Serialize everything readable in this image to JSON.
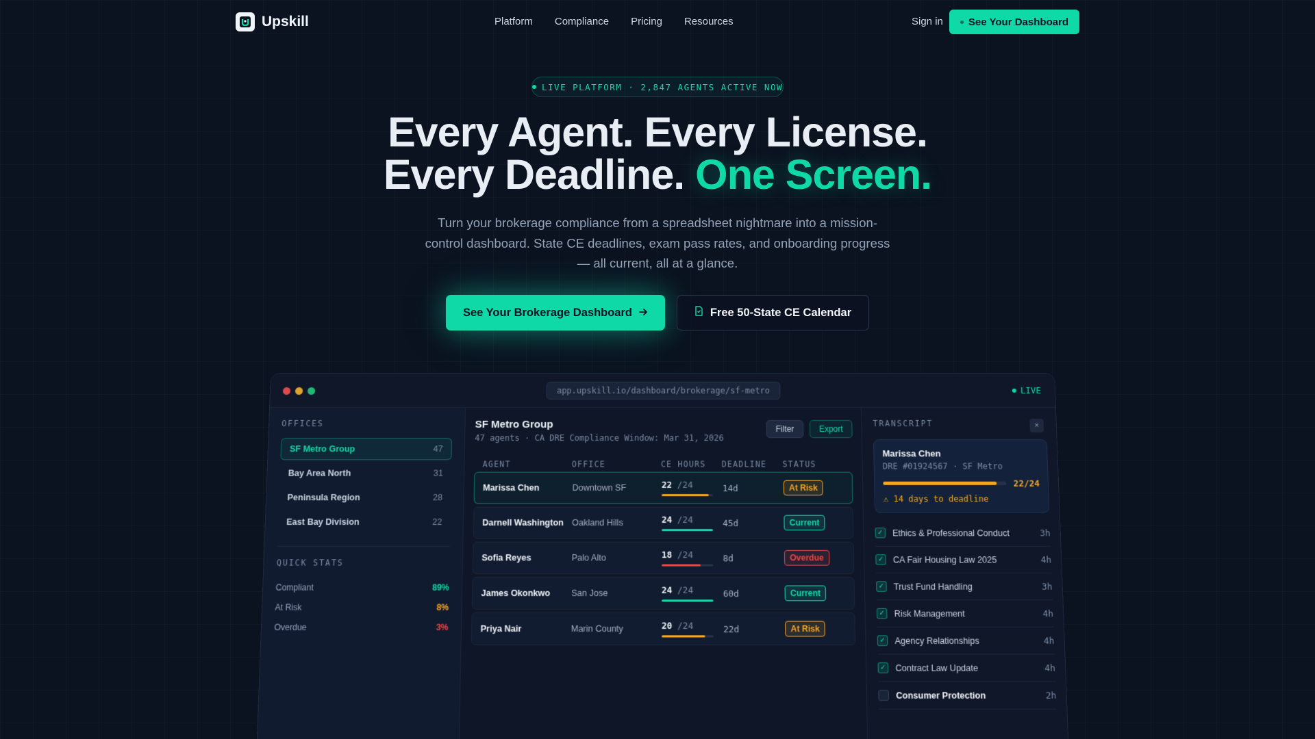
{
  "nav": {
    "brand": "Upskill",
    "links": [
      "Platform",
      "Compliance",
      "Pricing",
      "Resources"
    ],
    "signin": "Sign in",
    "cta": "See Your Dashboard"
  },
  "hero": {
    "pill": "LIVE PLATFORM · 2,847 AGENTS ACTIVE NOW",
    "headline_line1": "Every Agent. Every License.",
    "headline_line2_a": "Every Deadline. ",
    "headline_line2_b": "One Screen.",
    "subtitle": "Turn your brokerage compliance from a spreadsheet nightmare into a mission-control dashboard. State CE deadlines, exam pass rates, and onboarding progress — all current, all at a glance.",
    "cta_primary": "See Your Brokerage Dashboard",
    "cta_secondary": "Free 50-State CE Calendar"
  },
  "app": {
    "url": "app.upskill.io/dashboard/brokerage/sf-metro",
    "live": "LIVE",
    "sidebar": {
      "offices_label": "OFFICES",
      "offices": [
        {
          "name": "SF Metro Group",
          "count": "47"
        },
        {
          "name": "Bay Area North",
          "count": "31"
        },
        {
          "name": "Peninsula Region",
          "count": "28"
        },
        {
          "name": "East Bay Division",
          "count": "22"
        }
      ],
      "stats_label": "QUICK STATS",
      "stats": [
        {
          "label": "Compliant",
          "value": "89%",
          "color": "#10d9a8"
        },
        {
          "label": "At Risk",
          "value": "8%",
          "color": "#f5a623"
        },
        {
          "label": "Overdue",
          "value": "3%",
          "color": "#ef4444"
        }
      ]
    },
    "main": {
      "title": "SF Metro Group",
      "subtitle": "47 agents · CA DRE Compliance Window: Mar 31, 2026",
      "filter": "Filter",
      "export": "Export",
      "columns": [
        "AGENT",
        "OFFICE",
        "CE HOURS",
        "DEADLINE",
        "STATUS"
      ],
      "rows": [
        {
          "agent": "Marissa Chen",
          "office": "Downtown SF",
          "hours": "22",
          "of": "/24",
          "progress": 0.917,
          "deadline": "14d",
          "status": "At Risk",
          "tone": "risk"
        },
        {
          "agent": "Darnell Washington",
          "office": "Oakland Hills",
          "hours": "24",
          "of": "/24",
          "progress": 1.0,
          "deadline": "45d",
          "status": "Current",
          "tone": "ok"
        },
        {
          "agent": "Sofia Reyes",
          "office": "Palo Alto",
          "hours": "18",
          "of": "/24",
          "progress": 0.75,
          "deadline": "8d",
          "status": "Overdue",
          "tone": "bad"
        },
        {
          "agent": "James Okonkwo",
          "office": "San Jose",
          "hours": "24",
          "of": "/24",
          "progress": 1.0,
          "deadline": "60d",
          "status": "Current",
          "tone": "ok"
        },
        {
          "agent": "Priya Nair",
          "office": "Marin County",
          "hours": "20",
          "of": "/24",
          "progress": 0.833,
          "deadline": "22d",
          "status": "At Risk",
          "tone": "risk"
        }
      ],
      "tones": {
        "ok": "#10d9a8",
        "risk": "#f5a623",
        "bad": "#ef4444"
      }
    },
    "transcript": {
      "label": "TRANSCRIPT",
      "close": "×",
      "name": "Marissa Chen",
      "id": "DRE #01924567 · SF Metro",
      "progress": 0.917,
      "progress_text": "22/24",
      "warning": "⚠ 14 days to deadline",
      "courses": [
        {
          "name": "Ethics & Professional Conduct",
          "hours": "3h",
          "done": true
        },
        {
          "name": "CA Fair Housing Law 2025",
          "hours": "4h",
          "done": true
        },
        {
          "name": "Trust Fund Handling",
          "hours": "3h",
          "done": true
        },
        {
          "name": "Risk Management",
          "hours": "4h",
          "done": true
        },
        {
          "name": "Agency Relationships",
          "hours": "4h",
          "done": true
        },
        {
          "name": "Contract Law Update",
          "hours": "4h",
          "done": true
        },
        {
          "name": "Consumer Protection",
          "hours": "2h",
          "done": false
        }
      ]
    }
  },
  "icons": {
    "logo": "upskill-logo-icon",
    "arrow": "arrow-right-icon",
    "document": "document-icon",
    "check": "check-icon",
    "close": "close-icon"
  }
}
